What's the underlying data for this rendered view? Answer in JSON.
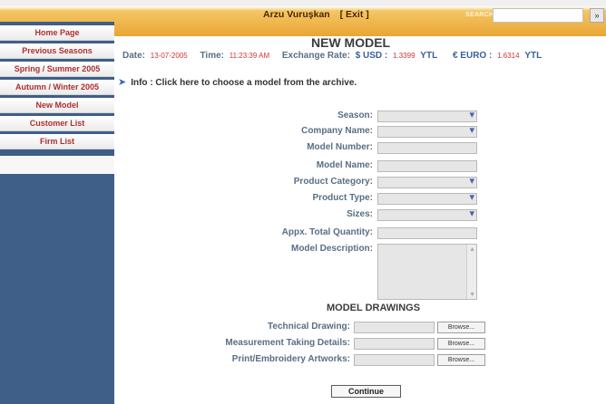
{
  "header": {
    "user_name": "Arzu Vuruşkan",
    "exit_label": "[ Exit ]",
    "search_label": "SEARCH",
    "search_value": "",
    "search_button": "»"
  },
  "sidebar": {
    "items": [
      {
        "label": "Home Page"
      },
      {
        "label": "Previous Seasons"
      },
      {
        "label": "Spring / Summer 2005"
      },
      {
        "label": "Autumn / Winter 2005"
      },
      {
        "label": "New Model"
      },
      {
        "label": "Customer List"
      },
      {
        "label": "Firm List"
      }
    ]
  },
  "main": {
    "title": "NEW MODEL",
    "date_label": "Date:",
    "date_value": "13-07-2005",
    "time_label": "Time:",
    "time_value": "11:23:39 AM",
    "exchange_label": "Exchange Rate:",
    "usd_label": "$ USD :",
    "usd_value": "1.3399",
    "usd_unit": "YTL",
    "euro_label": "€ EURO :",
    "euro_value": "1.6314",
    "euro_unit": "YTL",
    "info_text": "Info : Click here to choose a model from the archive."
  },
  "form": {
    "season": "Season:",
    "company_name": "Company Name:",
    "model_number": "Model Number:",
    "model_name": "Model Name:",
    "product_category": "Product Category:",
    "product_type": "Product Type:",
    "sizes": "Sizes:",
    "total_quantity": "Appx. Total Quantity:",
    "model_description": "Model Description:"
  },
  "drawings": {
    "title": "MODEL DRAWINGS",
    "technical_drawing": "Technical Drawing:",
    "measurement_details": "Measurement Taking Details:",
    "print_artworks": "Print/Embroidery Artworks:",
    "browse_label": "Browse..."
  },
  "continue_label": "Continue",
  "colors": {
    "header_orange": "#eaa533",
    "sidebar_blue": "#3f5e88",
    "nav_text": "#b02f2f",
    "label_text": "#596e83",
    "value_red": "#d23535"
  },
  "icons": {
    "info_arrow": "arrow-right-icon",
    "dropdown": "chevron-down-icon"
  }
}
